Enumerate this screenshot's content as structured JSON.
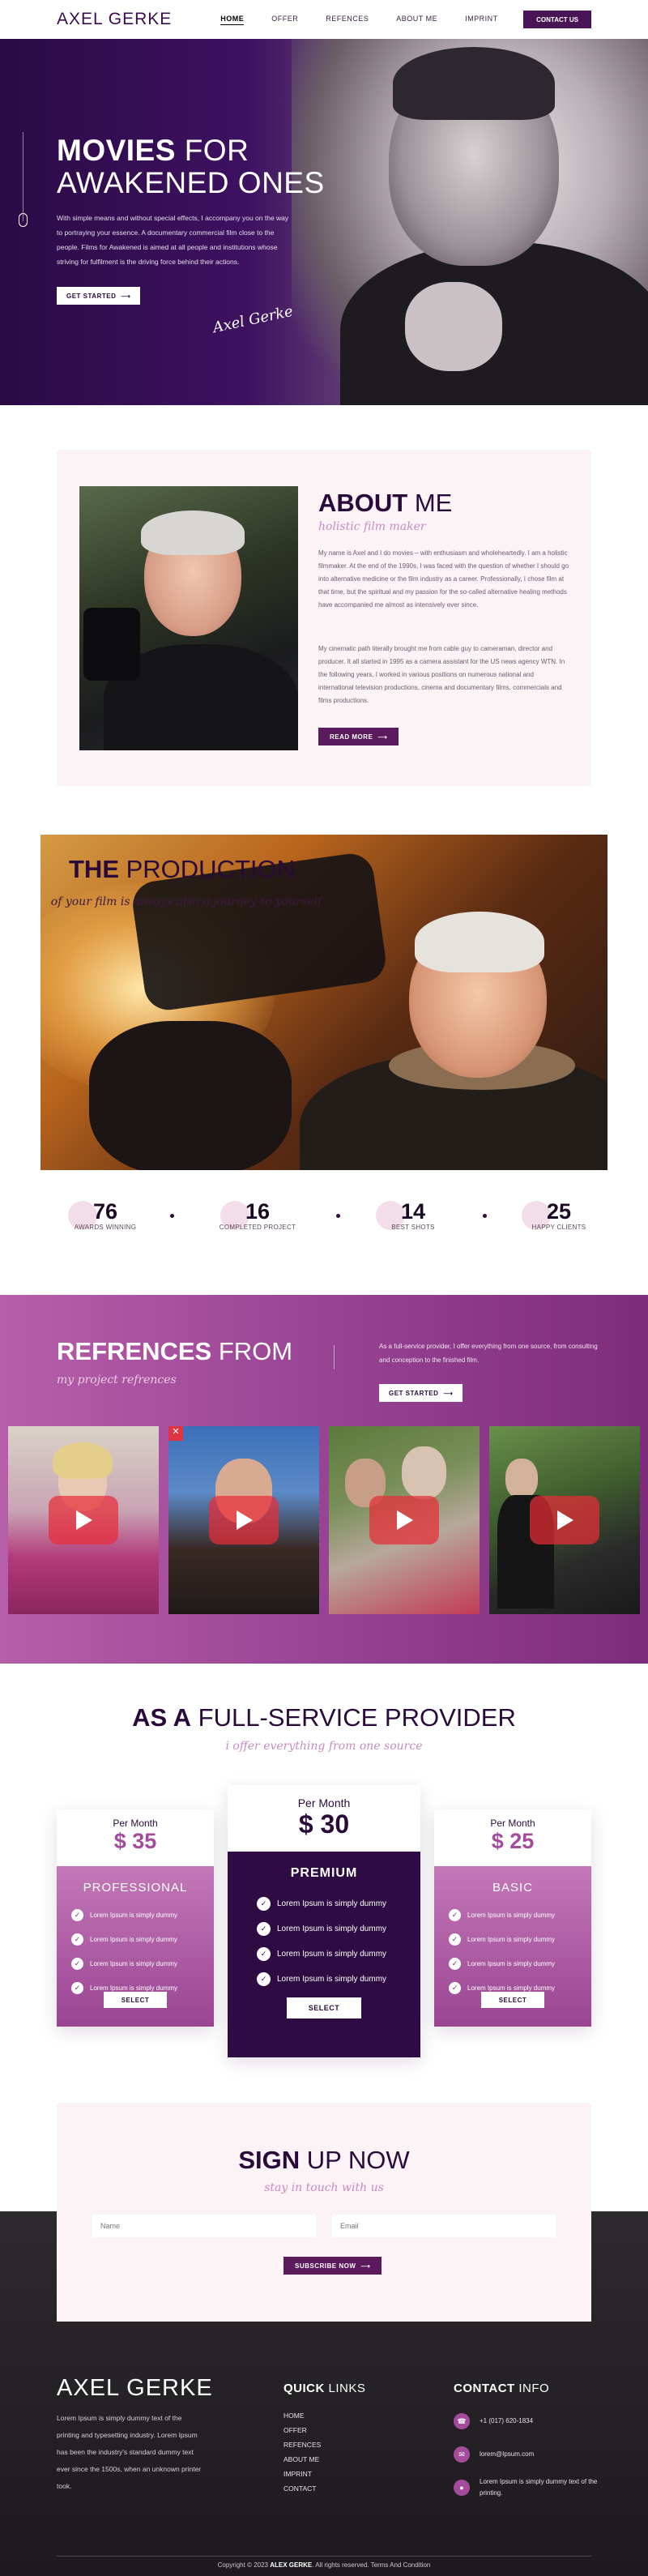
{
  "nav": {
    "logo": "AXEL GERKE",
    "links": [
      "HOME",
      "OFFER",
      "REFENCES",
      "ABOUT ME",
      "IMPRINT"
    ],
    "cta": "CONTACT US"
  },
  "hero": {
    "title_bold": "MOVIES",
    "title_rest": " FOR",
    "title_line2": "AWAKENED ONES",
    "text": "With simple means and without special effects, I accompany you on the way to portraying your essence. A documentary commercial film close to the people. Films for Awakened is aimed at all people and institutions whose striving for fulfilment is the driving force behind their actions.",
    "button": "GET STARTED",
    "signature": "Axel Gerke"
  },
  "about": {
    "title_bold": "ABOUT",
    "title_rest": " ME",
    "subtitle": "holistic film maker",
    "para1": "My name is Axel and I do movies – with enthusiasm and wholeheartedly. I am a holistic filmmaker. At the end of the 1990s, I was faced with the question of whether I should go into alternative medicine or the film industry as a career. Professionally, I chose film at that time, but the spiritual and my passion for the so-called alternative healing methods have accompanied me almost as intensively ever since.",
    "para2": "My cinematic path literally brought me from cable guy to cameraman, director and producer. It all started in 1995 as a camera assistant for the US news agency WTN. In the following years, I worked in various positions on numerous national and international television productions, cinema and documentary films, commercials and films productions.",
    "button": "READ MORE"
  },
  "production": {
    "title_bold": "THE",
    "title_rest": " PRODUCTION",
    "subtitle": "of your film is always also a journey to yourself"
  },
  "stats": [
    {
      "number": "76",
      "label": "AWARDS WINNING"
    },
    {
      "number": "16",
      "label": "COMPLETED PROJECT"
    },
    {
      "number": "14",
      "label": "BEST SHOTS"
    },
    {
      "number": "25",
      "label": "HAPPY CLIENTS"
    }
  ],
  "references": {
    "title_bold": "REFRENCES",
    "title_rest": " FROM",
    "subtitle": "my project refrences",
    "text": "As a full-service provider, I offer everything from one source, from consulting and conception to the finished film.",
    "button": "GET STARTED"
  },
  "pricing": {
    "title_bold": "AS A",
    "title_rest": " FULL-SERVICE PROVIDER",
    "subtitle": "i offer everything from one source",
    "per_month": "Per Month",
    "plans": [
      {
        "name": "PROFESSIONAL",
        "price": "$ 35",
        "button": "SELECT",
        "features": [
          "Lorem Ipsum is simply dummy",
          "Lorem Ipsum is simply dummy",
          "Lorem Ipsum is simply dummy",
          "Lorem Ipsum is simply dummy"
        ]
      },
      {
        "name": "PREMIUM",
        "price": "$ 30",
        "button": "SELECT",
        "features": [
          "Lorem Ipsum is simply dummy",
          "Lorem Ipsum is simply dummy",
          "Lorem Ipsum is simply dummy",
          "Lorem Ipsum is simply dummy"
        ]
      },
      {
        "name": "BASIC",
        "price": "$ 25",
        "button": "SELECT",
        "features": [
          "Lorem Ipsum is simply dummy",
          "Lorem Ipsum is simply dummy",
          "Lorem Ipsum is simply dummy",
          "Lorem Ipsum is simply dummy"
        ]
      }
    ]
  },
  "signup": {
    "title_bold": "SIGN",
    "title_rest": " UP NOW",
    "subtitle": "stay in touch with us",
    "name_placeholder": "Name",
    "email_placeholder": "Email",
    "button": "SUBSCRIBE NOW"
  },
  "footer": {
    "logo": "AXEL GERKE",
    "about": "Lorem Ipsum is simply dummy text of the printing and typesetting industry. Lorem Ipsum has been the industry's standard dummy text ever since the 1500s, when an unknown printer took.",
    "links_title_bold": "QUICK",
    "links_title_rest": " LINKS",
    "links": [
      "HOME",
      "OFFER",
      "REFENCES",
      "ABOUT ME",
      "IMPRINT",
      "CONTACT"
    ],
    "contact_title_bold": "CONTACT",
    "contact_title_rest": " INFO",
    "phone": "+1 (017) 620-1834",
    "email": "lorem@Ipsum.com",
    "address": "Lorem Ipsum is simply dummy text of the printing.",
    "copyright_pre": "Copyright © 2023",
    "copyright_brand": "ALEX GERKE",
    "copyright_post": ". All rights reserved. Terms And Condition"
  },
  "colors": {
    "brand_dark": "#3b0c4f",
    "accent": "#a54b9c",
    "pink_bg": "#fbf3f6"
  }
}
